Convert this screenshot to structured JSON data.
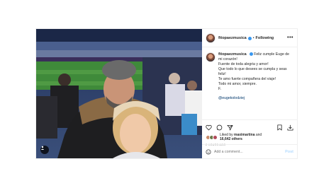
{
  "post": {
    "username": "fitopaezmusica",
    "follow_label": "Following",
    "more_label": "•••",
    "caption": {
      "lines": [
        "Feliz cumple Euge de mi corazón!",
        "Fuente de toda alegria y amor!",
        "Que todo lo que desees se cumpla y seas feliz!",
        "Te amo fuerte compañera del viaje!",
        "Todo mi amor, siempre.",
        "F."
      ],
      "mention": "@eugekolodziej"
    },
    "likes": {
      "prefix": "Liked by",
      "user": "maximartina",
      "conjunction": "and",
      "others": "16,642 others"
    },
    "time": "2 HOURS AGO",
    "comment": {
      "placeholder": "Add a comment...",
      "post_label": "Post"
    },
    "icons": {
      "like": "heart-icon",
      "comment": "comment-icon",
      "share": "paper-plane-icon",
      "save": "bookmark-icon",
      "download": "download-icon",
      "emoji": "smiley-icon",
      "tag": "user-tag-icon"
    },
    "colors": {
      "verified": "#3897f0",
      "mention": "#00376b",
      "post_button": "#b3dbff",
      "muted": "#8e8e8e"
    }
  }
}
